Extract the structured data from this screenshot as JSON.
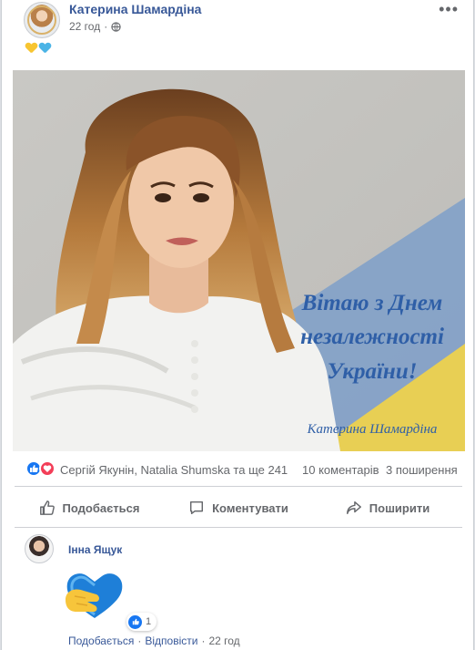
{
  "post": {
    "author": "Катерина Шамардіна",
    "time": "22 год",
    "separator": "·",
    "more_icon": "•••",
    "text_hearts": [
      "yellow-heart",
      "blue-heart"
    ],
    "image_caption": {
      "line1": "Вітаю з Днем",
      "line2": "незалежності",
      "line3": "України!",
      "signature": "Катерина Шамардіна"
    }
  },
  "stats": {
    "reactions": [
      "like",
      "love"
    ],
    "names": "Сергій Якунін, Natalia Shumska та ще 241",
    "comments": "10 коментарів",
    "shares": "3 поширення"
  },
  "actions": {
    "like": "Подобається",
    "comment": "Коментувати",
    "share": "Поширити"
  },
  "comment": {
    "author": "Інна Ящук",
    "sticker": "blue-heart-hand-sticker",
    "reaction_count": "1",
    "like_link": "Подобається",
    "reply_link": "Відповісти",
    "time": "22 год",
    "separator": "·"
  },
  "colors": {
    "link_blue": "#385898",
    "like_blue": "#1877f2",
    "love_red": "#f33e58",
    "flag_blue": "#7e9fc9",
    "flag_yellow": "#e8cf54",
    "caption_blue": "#2f5fa7"
  }
}
